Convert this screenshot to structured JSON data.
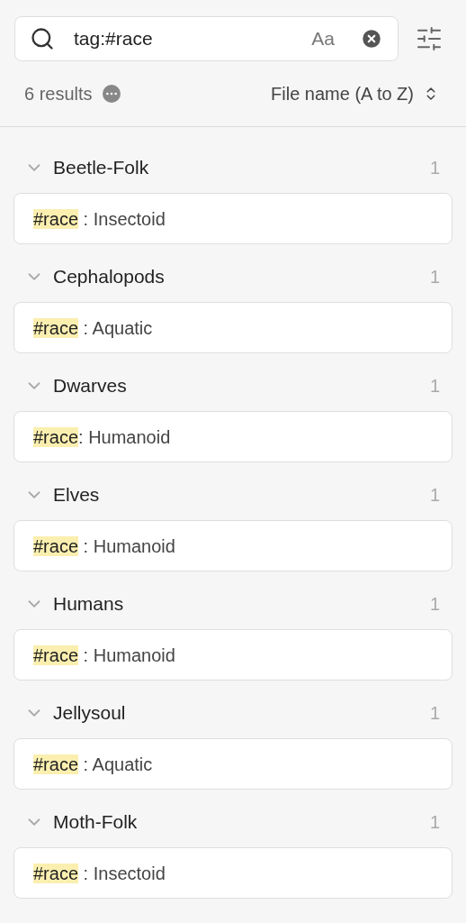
{
  "search": {
    "value": "tag:#race",
    "match_case_label": "Aa"
  },
  "summary": {
    "count": "6 results",
    "sort": "File name (A to Z)"
  },
  "groups": [
    {
      "title": "Beetle-Folk",
      "count": "1",
      "expanded": true,
      "matches": [
        {
          "tag": "#race",
          "rest": " : Insectoid"
        }
      ]
    },
    {
      "title": "Cephalopods",
      "count": "1",
      "expanded": true,
      "matches": [
        {
          "tag": "#race",
          "rest": " : Aquatic"
        }
      ]
    },
    {
      "title": "Dwarves",
      "count": "1",
      "expanded": true,
      "matches": [
        {
          "tag": "#race",
          "rest": ": Humanoid"
        }
      ]
    },
    {
      "title": "Elves",
      "count": "1",
      "expanded": true,
      "matches": [
        {
          "tag": "#race",
          "rest": " : Humanoid"
        }
      ]
    },
    {
      "title": "Humans",
      "count": "1",
      "expanded": true,
      "matches": [
        {
          "tag": "#race",
          "rest": " : Humanoid"
        }
      ]
    },
    {
      "title": "Jellysoul",
      "count": "1",
      "expanded": true,
      "matches": [
        {
          "tag": "#race",
          "rest": " : Aquatic"
        }
      ]
    },
    {
      "title": "Moth-Folk",
      "count": "1",
      "expanded": true,
      "matches": [
        {
          "tag": "#race",
          "rest": " : Insectoid"
        }
      ]
    }
  ]
}
